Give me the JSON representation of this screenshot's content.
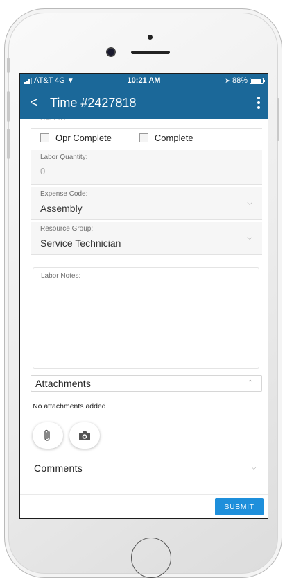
{
  "status_bar": {
    "carrier": "AT&T 4G",
    "time": "10:21 AM",
    "battery": "88%"
  },
  "app_bar": {
    "back_glyph": "<",
    "title": "Time #2427818",
    "menu_icon": "more-vertical-icon"
  },
  "form": {
    "cut_off_label": "REPAIR",
    "opr_complete_label": "Opr Complete",
    "complete_label": "Complete",
    "labor_quantity": {
      "label": "Labor Quantity:",
      "value": "0"
    },
    "expense_code": {
      "label": "Expense Code:",
      "value": "Assembly"
    },
    "resource_group": {
      "label": "Resource Group:",
      "value": "Service Technician"
    },
    "labor_notes": {
      "label": "Labor Notes:",
      "value": ""
    }
  },
  "attachments": {
    "title": "Attachments",
    "empty_text": "No attachments added",
    "buttons": [
      "paperclip-icon",
      "camera-icon"
    ]
  },
  "comments": {
    "title": "Comments"
  },
  "submit_label": "SUBMIT",
  "colors": {
    "app_bar": "#1b6899",
    "submit": "#1e8fdb"
  }
}
